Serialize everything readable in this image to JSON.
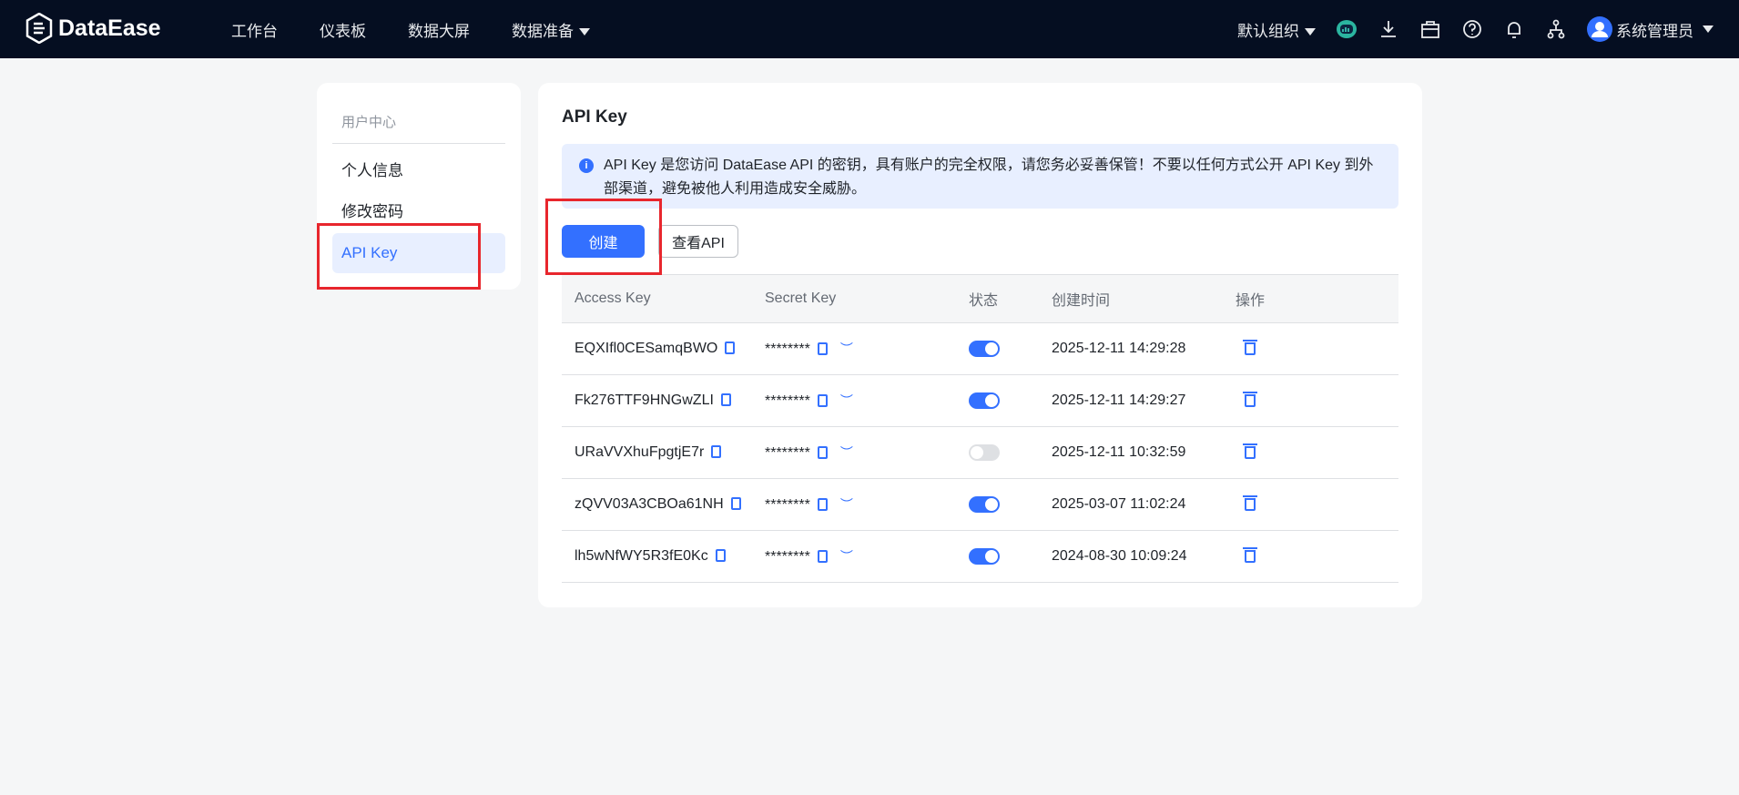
{
  "header": {
    "brand": "DataEase",
    "nav": [
      "工作台",
      "仪表板",
      "数据大屏",
      "数据准备"
    ],
    "org": "默认组织",
    "user": "系统管理员"
  },
  "sidebar": {
    "title": "用户中心",
    "items": [
      "个人信息",
      "修改密码",
      "API Key"
    ]
  },
  "main": {
    "title": "API Key",
    "alert": "API Key 是您访问 DataEase API 的密钥，具有账户的完全权限，请您务必妥善保管！不要以任何方式公开 API Key 到外部渠道，避免被他人利用造成安全威胁。",
    "create_label": "创建",
    "view_api_label": "查看API"
  },
  "table": {
    "headers": [
      "Access Key",
      "Secret Key",
      "状态",
      "创建时间",
      "操作"
    ],
    "rows": [
      {
        "access_key": "EQXIfl0CESamqBWO",
        "secret": "********",
        "enabled": true,
        "created": "2025-12-11 14:29:28"
      },
      {
        "access_key": "Fk276TTF9HNGwZLI",
        "secret": "********",
        "enabled": true,
        "created": "2025-12-11 14:29:27"
      },
      {
        "access_key": "URaVVXhuFpgtjE7r",
        "secret": "********",
        "enabled": false,
        "created": "2025-12-11 10:32:59"
      },
      {
        "access_key": "zQVV03A3CBOa61NH",
        "secret": "********",
        "enabled": true,
        "created": "2025-03-07 11:02:24"
      },
      {
        "access_key": "lh5wNfWY5R3fE0Kc",
        "secret": "********",
        "enabled": true,
        "created": "2024-08-30 10:09:24"
      }
    ]
  },
  "colors": {
    "accent": "#3370ff",
    "header_bg": "#050e21",
    "highlight": "#e8262d"
  }
}
